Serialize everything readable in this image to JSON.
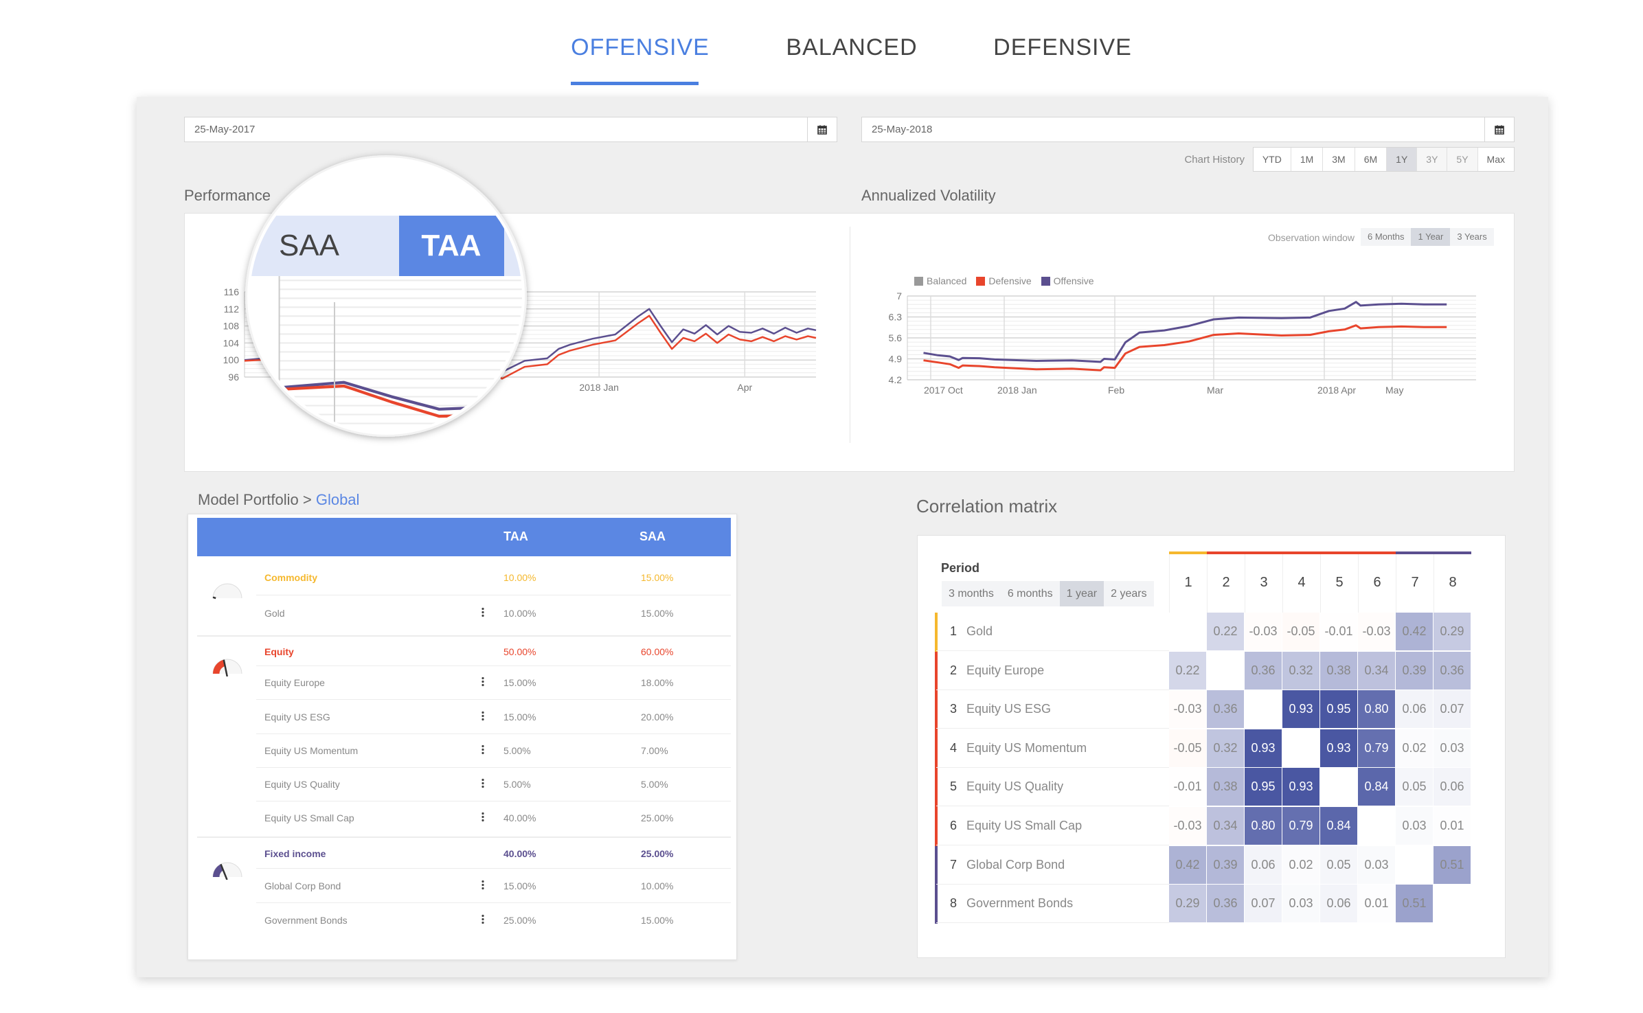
{
  "tabs": [
    {
      "label": "OFFENSIVE",
      "active": true
    },
    {
      "label": "BALANCED",
      "active": false
    },
    {
      "label": "DEFENSIVE",
      "active": false
    }
  ],
  "colors": {
    "accent": "#4a7fe0",
    "header_blue": "#5b87e3",
    "commodity": "#f5b82e",
    "equity": "#e8452c",
    "fixed_income": "#5b4f8f",
    "balanced": "#999999"
  },
  "filters": {
    "start_date": "25-May-2017",
    "end_date": "25-May-2018",
    "calendar_icon": "calendar-icon",
    "chart_history_label": "Chart History",
    "chart_history_options": [
      "YTD",
      "1M",
      "3M",
      "6M",
      "1Y",
      "3Y",
      "5Y",
      "Max"
    ],
    "chart_history_selected": "1Y"
  },
  "performance": {
    "title": "Performance",
    "magnifier": {
      "saa_label": "SAA",
      "taa_label": "TAA",
      "selected": "TAA"
    }
  },
  "volatility": {
    "title": "Annualized Volatility",
    "observation_label": "Observation window",
    "observation_options": [
      "6 Months",
      "1 Year",
      "3 Years"
    ],
    "observation_selected": "1 Year",
    "legend": [
      "Balanced",
      "Defensive",
      "Offensive"
    ]
  },
  "chart_data": [
    {
      "type": "line",
      "title": "",
      "ylim": [
        96,
        116
      ],
      "yticks": [
        96,
        100,
        104,
        108,
        112,
        116
      ],
      "xticks": [
        {
          "date": "2018-01-01",
          "label": "2018 Jan"
        },
        {
          "date": "2018-04-01",
          "label": "Apr"
        }
      ],
      "xlim": [
        "2017-05-27",
        "2018-05-15"
      ],
      "grid": true,
      "x": [
        "2017-05-27",
        "2017-06-15",
        "2017-06-29",
        "2017-07-13",
        "2017-07-27",
        "2017-08-10",
        "2017-08-24",
        "2017-09-07",
        "2017-09-21",
        "2017-10-05",
        "2017-10-19",
        "2017-11-02",
        "2017-11-16",
        "2017-11-30",
        "2017-12-07",
        "2017-12-14",
        "2017-12-28",
        "2018-01-11",
        "2018-01-25",
        "2018-02-01",
        "2018-02-08",
        "2018-02-15",
        "2018-02-22",
        "2018-03-01",
        "2018-03-08",
        "2018-03-15",
        "2018-03-22",
        "2018-03-29",
        "2018-04-05",
        "2018-04-12",
        "2018-04-19",
        "2018-04-26",
        "2018-05-03",
        "2018-05-10",
        "2018-05-15"
      ],
      "series": [
        {
          "color": "#5b4f8f",
          "values": [
            100.0,
            100.6,
            99.0,
            97.6,
            97.8,
            98.6,
            99.8,
            101.8,
            103.4,
            105.6,
            102.8,
            97.2,
            99.8,
            100.4,
            102.6,
            103.6,
            105.0,
            106.0,
            110.2,
            112.0,
            108.0,
            104.2,
            107.2,
            106.2,
            108.2,
            106.0,
            108.0,
            106.6,
            106.4,
            107.4,
            106.2,
            107.6,
            106.4,
            107.4,
            107.0
          ]
        },
        {
          "color": "#e8452c",
          "values": [
            99.8,
            100.2,
            98.4,
            96.8,
            96.9,
            97.3,
            98.4,
            100.2,
            101.8,
            103.9,
            101.2,
            95.6,
            98.4,
            99.0,
            101.2,
            102.2,
            103.6,
            104.6,
            108.6,
            110.4,
            106.4,
            102.6,
            105.2,
            104.4,
            106.2,
            104.0,
            106.0,
            104.8,
            104.4,
            105.4,
            104.4,
            105.6,
            104.8,
            105.6,
            105.2
          ]
        }
      ]
    },
    {
      "type": "line",
      "title": "",
      "ylim": [
        4.2,
        7
      ],
      "yticks": [
        4.2,
        4.9,
        5.6,
        6.3,
        7
      ],
      "xticks": [
        {
          "date": "2017-10-01",
          "label": "2017 Oct"
        },
        {
          "date": "2018-01-01",
          "label": "2018 Jan"
        },
        {
          "date": "2018-02-01",
          "label": "Feb"
        },
        {
          "date": "2018-03-01",
          "label": "Mar"
        },
        {
          "date": "2018-04-01",
          "label": "2018 Apr"
        },
        {
          "date": "2018-05-01",
          "label": "May"
        }
      ],
      "grid": true,
      "legend_position": "top-left",
      "x": [
        "2017-09-22",
        "2017-10-10",
        "2017-10-25",
        "2017-11-05",
        "2017-11-10",
        "2017-12-01",
        "2017-12-20",
        "2018-01-10",
        "2018-01-20",
        "2018-01-28",
        "2018-01-29",
        "2018-02-01",
        "2018-02-04",
        "2018-02-08",
        "2018-02-15",
        "2018-02-22",
        "2018-03-01",
        "2018-03-08",
        "2018-03-20",
        "2018-03-28",
        "2018-04-03",
        "2018-04-10",
        "2018-04-15",
        "2018-04-17",
        "2018-04-25",
        "2018-05-05",
        "2018-05-15",
        "2018-05-25"
      ],
      "series": [
        {
          "name": "Offensive",
          "color": "#5b4f8f",
          "values": [
            5.1,
            5.02,
            4.98,
            4.86,
            4.93,
            4.92,
            4.88,
            4.83,
            4.85,
            4.8,
            4.9,
            4.88,
            5.45,
            5.78,
            5.85,
            6.0,
            6.22,
            6.28,
            6.26,
            6.28,
            6.5,
            6.58,
            6.8,
            6.68,
            6.72,
            6.74,
            6.72,
            6.72
          ]
        },
        {
          "name": "Defensive",
          "color": "#e8452c",
          "values": [
            4.85,
            4.78,
            4.72,
            4.6,
            4.68,
            4.66,
            4.62,
            4.55,
            4.57,
            4.52,
            4.62,
            4.6,
            5.08,
            5.3,
            5.36,
            5.48,
            5.7,
            5.75,
            5.68,
            5.7,
            5.82,
            5.88,
            6.02,
            5.92,
            5.96,
            5.98,
            5.96,
            5.96
          ]
        },
        {
          "name": "Balanced",
          "color": "#999999",
          "values": [],
          "hidden": true
        }
      ]
    },
    {
      "type": "heatmap",
      "title": "Correlation matrix",
      "labels": [
        "Gold",
        "Equity Europe",
        "Equity US ESG",
        "Equity US Momentum",
        "Equity US Quality",
        "Equity US Small Cap",
        "Global Corp Bond",
        "Government Bonds"
      ],
      "groups": [
        "commodity",
        "equity",
        "equity",
        "equity",
        "equity",
        "equity",
        "fixed_income",
        "fixed_income"
      ],
      "values": [
        [
          null,
          "0.22",
          "-0.03",
          "-0.05",
          "-0.01",
          "-0.03",
          "0.42",
          "0.29"
        ],
        [
          "0.22",
          null,
          "0.36",
          "0.32",
          "0.38",
          "0.34",
          "0.39",
          "0.36"
        ],
        [
          "-0.03",
          "0.36",
          null,
          "0.93",
          "0.95",
          "0.80",
          "0.06",
          "0.07"
        ],
        [
          "-0.05",
          "0.32",
          "0.93",
          null,
          "0.93",
          "0.79",
          "0.02",
          "0.03"
        ],
        [
          "-0.01",
          "0.38",
          "0.95",
          "0.93",
          null,
          "0.84",
          "0.05",
          "0.06"
        ],
        [
          "-0.03",
          "0.34",
          "0.80",
          "0.79",
          "0.84",
          null,
          "0.03",
          "0.01"
        ],
        [
          "0.42",
          "0.39",
          "0.06",
          "0.02",
          "0.05",
          "0.03",
          null,
          "0.51"
        ],
        [
          "0.29",
          "0.36",
          "0.07",
          "0.03",
          "0.06",
          "0.01",
          "0.51",
          null
        ]
      ]
    }
  ],
  "correlation": {
    "title": "Correlation matrix",
    "period_label": "Period",
    "period_options": [
      "3 months",
      "6 months",
      "1 year",
      "2 years"
    ],
    "period_selected": "1 year",
    "columns": [
      "1",
      "2",
      "3",
      "4",
      "5",
      "6",
      "7",
      "8"
    ]
  },
  "portfolio": {
    "title_prefix": "Model Portfolio >",
    "title_link": "Global",
    "headers": {
      "taa": "TAA",
      "saa": "SAA"
    },
    "menu_icon": "vertical-dots-icon",
    "groups": [
      {
        "name": "Commodity",
        "key": "commodity",
        "taa": "10.00%",
        "saa": "15.00%",
        "gauge_level": 0.02,
        "items": [
          {
            "name": "Gold",
            "taa": "10.00%",
            "saa": "15.00%"
          }
        ]
      },
      {
        "name": "Equity",
        "key": "equity",
        "taa": "50.00%",
        "saa": "60.00%",
        "gauge_level": 0.42,
        "items": [
          {
            "name": "Equity Europe",
            "taa": "15.00%",
            "saa": "18.00%"
          },
          {
            "name": "Equity US ESG",
            "taa": "15.00%",
            "saa": "20.00%"
          },
          {
            "name": "Equity US Momentum",
            "taa": "5.00%",
            "saa": "7.00%"
          },
          {
            "name": "Equity US Quality",
            "taa": "5.00%",
            "saa": "5.00%"
          },
          {
            "name": "Equity US Small Cap",
            "taa": "40.00%",
            "saa": "25.00%"
          }
        ]
      },
      {
        "name": "Fixed income",
        "key": "fixed_income",
        "taa": "40.00%",
        "saa": "25.00%",
        "gauge_level": 0.35,
        "items": [
          {
            "name": "Global Corp Bond",
            "taa": "15.00%",
            "saa": "10.00%"
          },
          {
            "name": "Government Bonds",
            "taa": "25.00%",
            "saa": "15.00%"
          }
        ]
      }
    ]
  }
}
